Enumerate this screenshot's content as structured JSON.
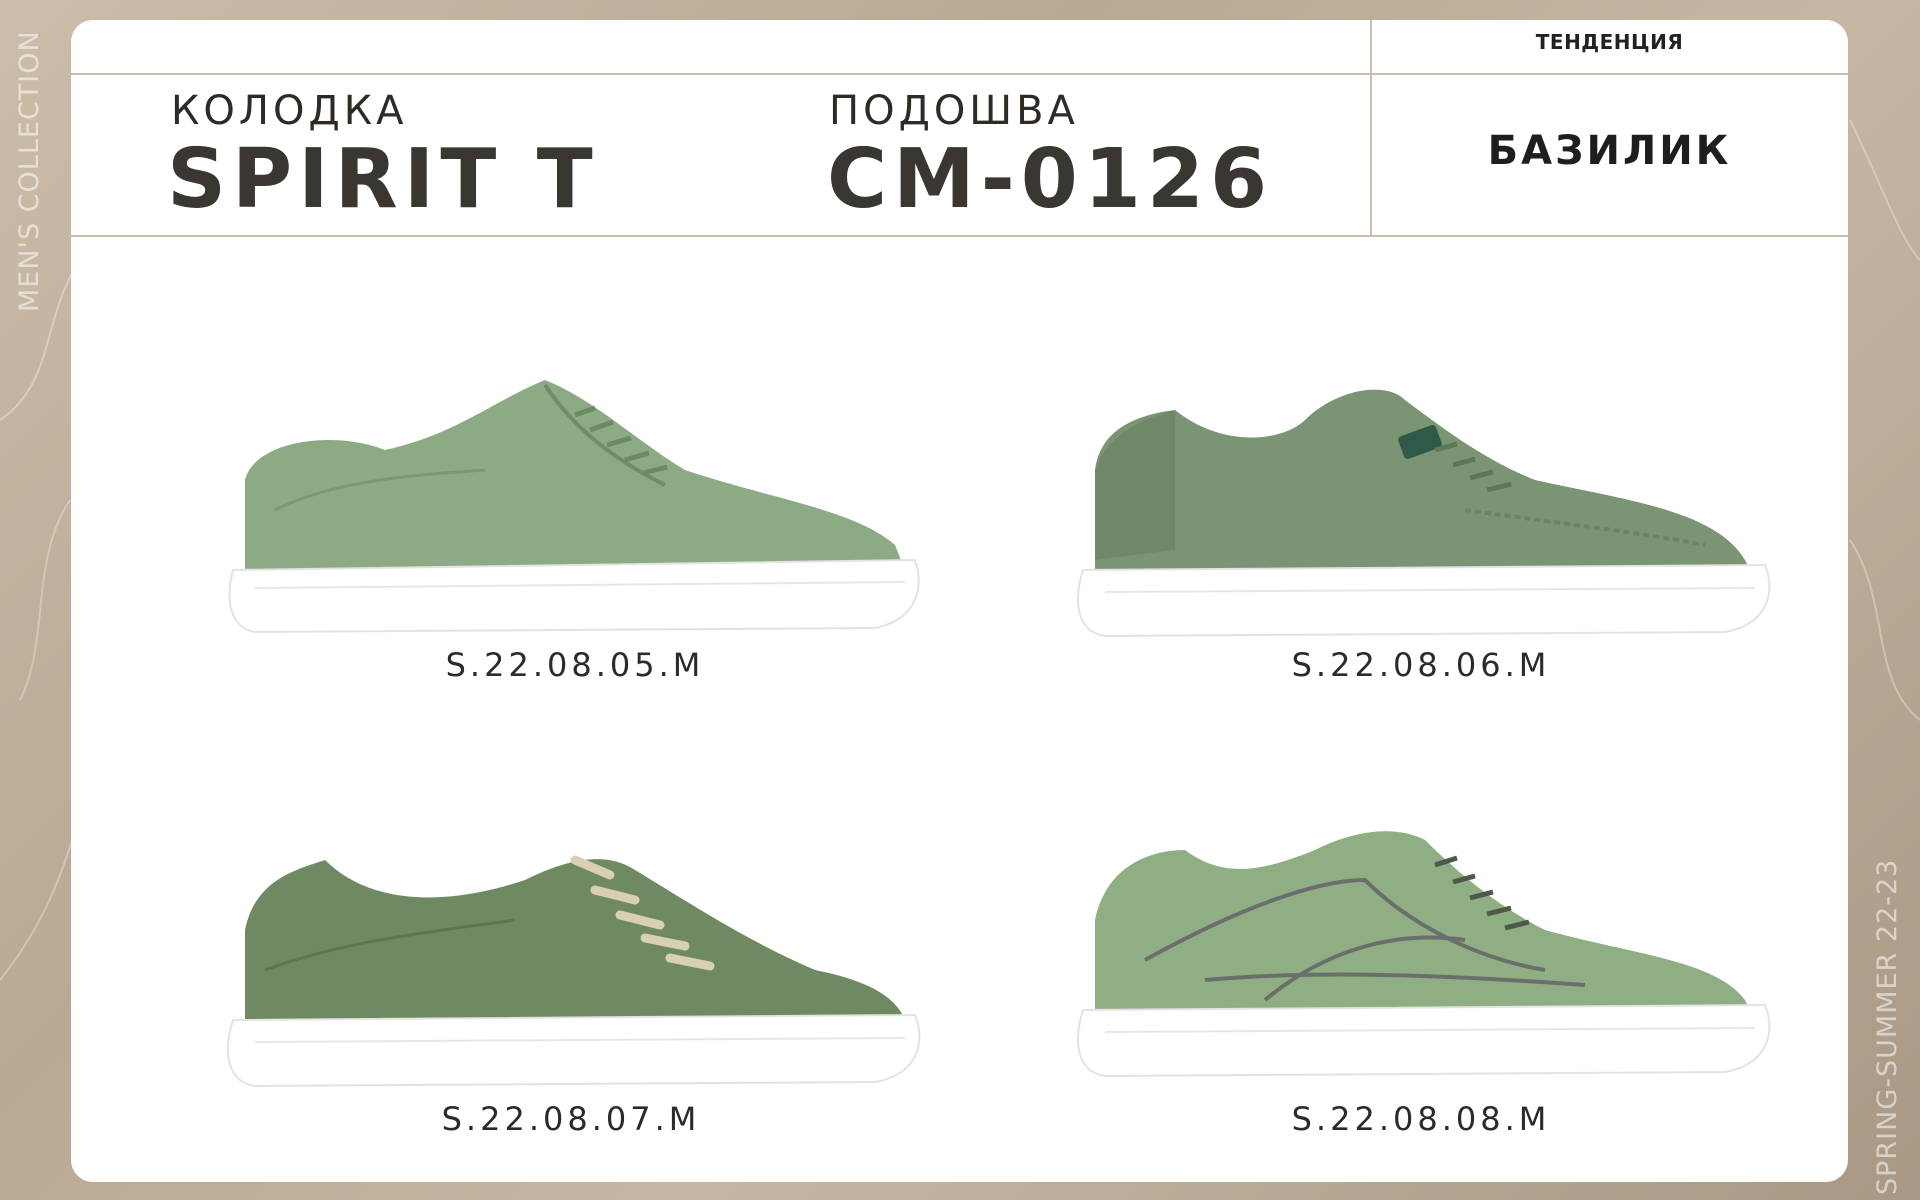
{
  "side_left": "MEN'S COLLECTION",
  "side_right": "SPRING-SUMMER 22-23",
  "header": {
    "last_label": "КОЛОДКА",
    "last_value": "SPIRIT T",
    "sole_label": "ПОДОШВА",
    "sole_value": "CM-0126",
    "trend_label": "ТЕНДЕНЦИЯ",
    "trend_value": "БАЗИЛИК"
  },
  "products": [
    {
      "sku": "S.22.08.05.M",
      "icon": "sneaker-suede-image",
      "color": "#8cab84"
    },
    {
      "sku": "S.22.08.06.M",
      "icon": "sneaker-leather-image",
      "color": "#7b9474"
    },
    {
      "sku": "S.22.08.07.M",
      "icon": "sneaker-canvas-image",
      "color": "#6f8a62"
    },
    {
      "sku": "S.22.08.08.M",
      "icon": "sneaker-nubuck-image",
      "color": "#8fae83"
    }
  ],
  "colors": {
    "card": "#ffffff",
    "divider": "#c9bdaf",
    "text_dark": "#3a3631",
    "sole": "#ffffff"
  }
}
